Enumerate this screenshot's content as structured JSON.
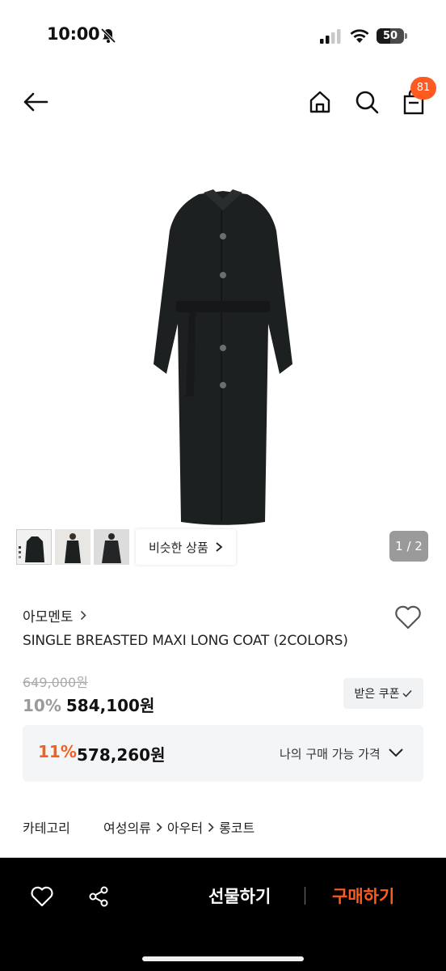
{
  "status_bar": {
    "time": "10:00",
    "battery_percent": "50",
    "battery_level": 0.5
  },
  "header": {
    "cart_badge": "81"
  },
  "gallery": {
    "similar_label": "비슷한 상품",
    "counter": "1 / 2"
  },
  "product": {
    "brand": "아모멘토",
    "name": "SINGLE BREASTED MAXI LONG COAT (2COLORS)",
    "original_price": "649,000원",
    "discount_rate": "10%",
    "sale_price": "584,100원",
    "coupon_label": "받은 쿠폰"
  },
  "my_price": {
    "rate": "11%",
    "price": "578,260원",
    "label": "나의 구매 가능 가격"
  },
  "category": {
    "label": "카테고리",
    "path": [
      "여성의류",
      "아우터",
      "롱코트"
    ]
  },
  "bottom_bar": {
    "gift_label": "선물하기",
    "buy_label": "구매하기"
  },
  "colors": {
    "accent": "#ff5a1f",
    "my_price_rate": "#f06122",
    "bottom_bar_bg": "#000000"
  }
}
